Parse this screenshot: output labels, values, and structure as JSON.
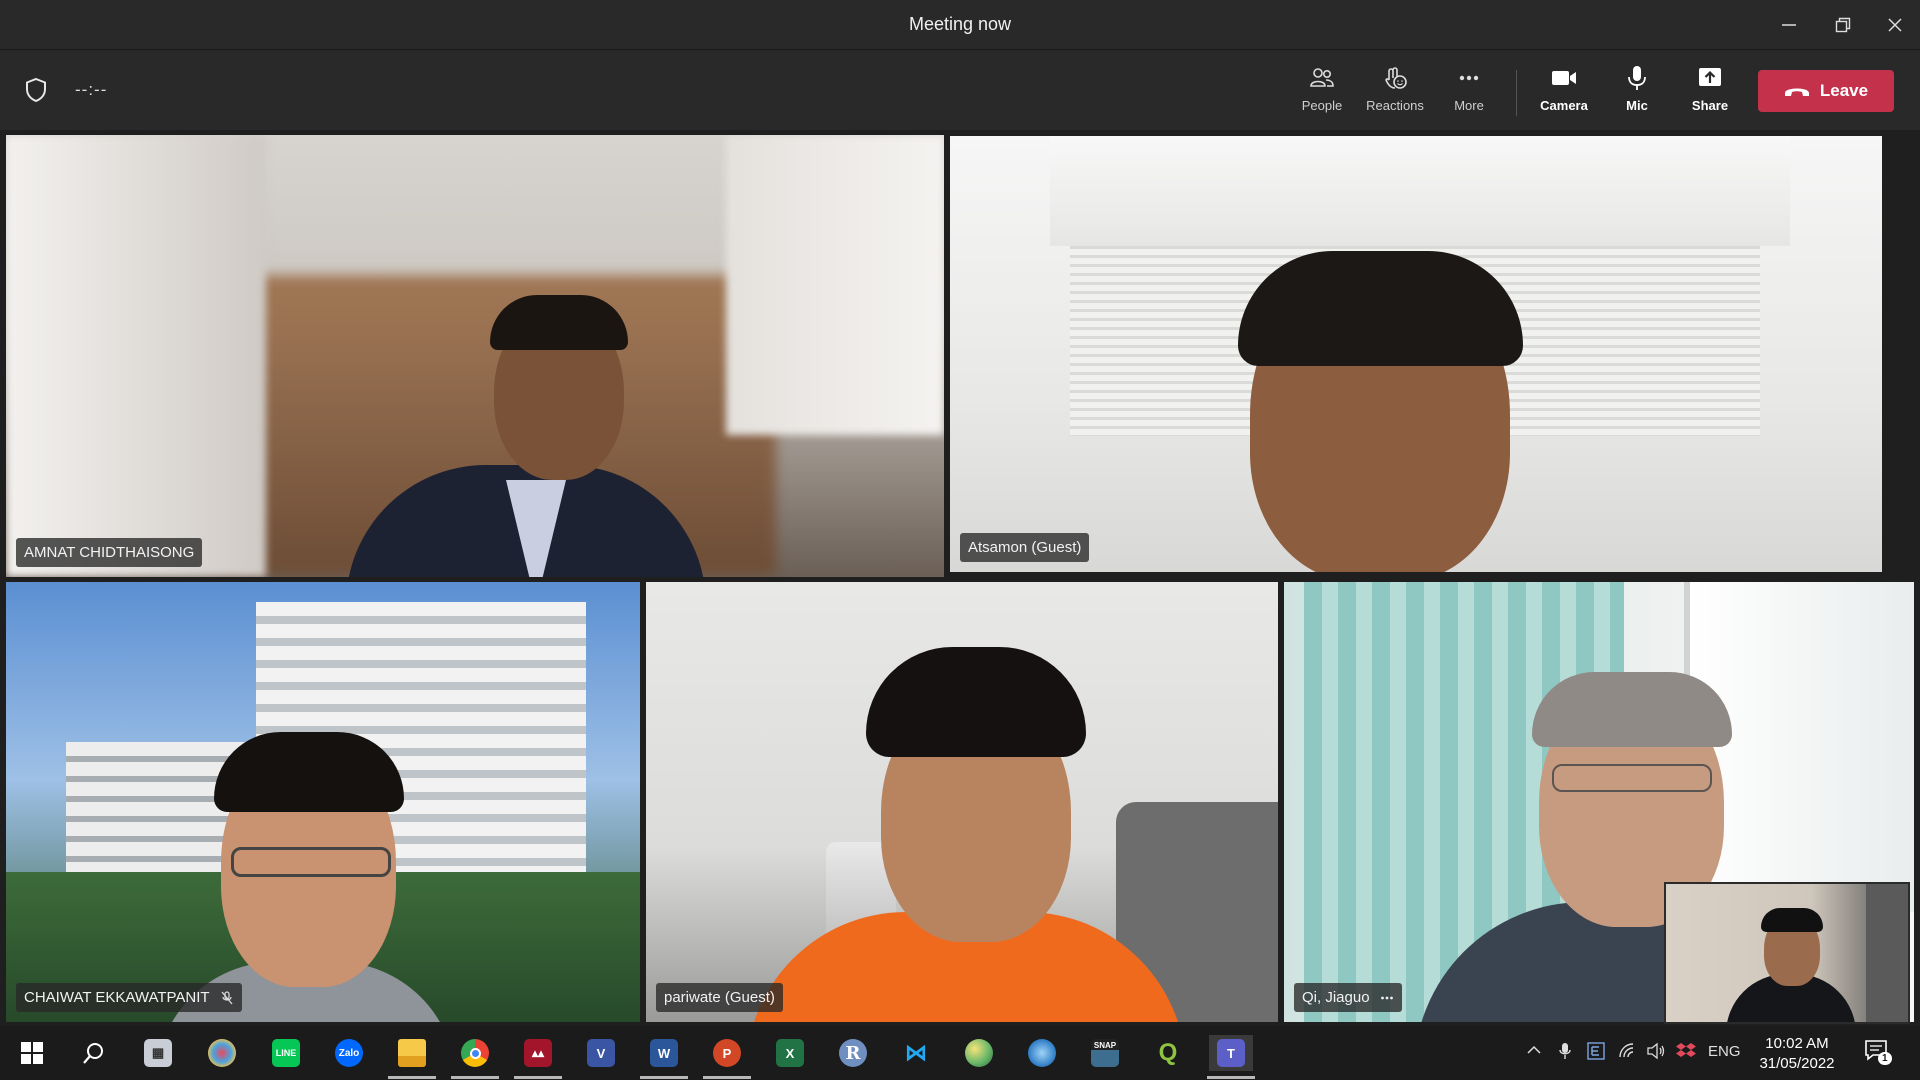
{
  "window": {
    "title": "Meeting now"
  },
  "toolbar": {
    "timer": "--:--",
    "people_label": "People",
    "reactions_label": "Reactions",
    "more_label": "More",
    "camera_label": "Camera",
    "mic_label": "Mic",
    "share_label": "Share",
    "leave_label": "Leave"
  },
  "participants": [
    {
      "name": "AMNAT CHIDTHAISONG",
      "speaking": false,
      "muted": false
    },
    {
      "name": "Atsamon (Guest)",
      "speaking": true,
      "muted": false
    },
    {
      "name": "CHAIWAT EKKAWATPANIT",
      "speaking": false,
      "muted": true
    },
    {
      "name": "pariwate (Guest)",
      "speaking": false,
      "muted": false
    },
    {
      "name": "Qi, Jiaguo",
      "speaking": true,
      "muted": false,
      "more_icon": "more-icon"
    }
  ],
  "taskbar": {
    "apps": [
      "start-icon",
      "search-icon",
      "task-view-icon",
      "paint-icon",
      "line-icon",
      "zalo-icon",
      "file-explorer-icon",
      "chrome-icon",
      "mendeley-icon",
      "visio-icon",
      "word-icon",
      "powerpoint-icon",
      "excel-icon",
      "r-icon",
      "vscode-icon",
      "earth-icon",
      "magnifier-icon",
      "snap-icon",
      "qgis-icon",
      "teams-icon"
    ],
    "zalo_text": "Zalo",
    "r_text": "R",
    "snap_text": "SNAP",
    "language": "ENG",
    "time": "10:02 AM",
    "date": "31/05/2022",
    "notification_count": "1"
  },
  "colors": {
    "leave": "#c4314b",
    "speaking_outline": "#8b8cc7",
    "titlebar": "#292929"
  }
}
